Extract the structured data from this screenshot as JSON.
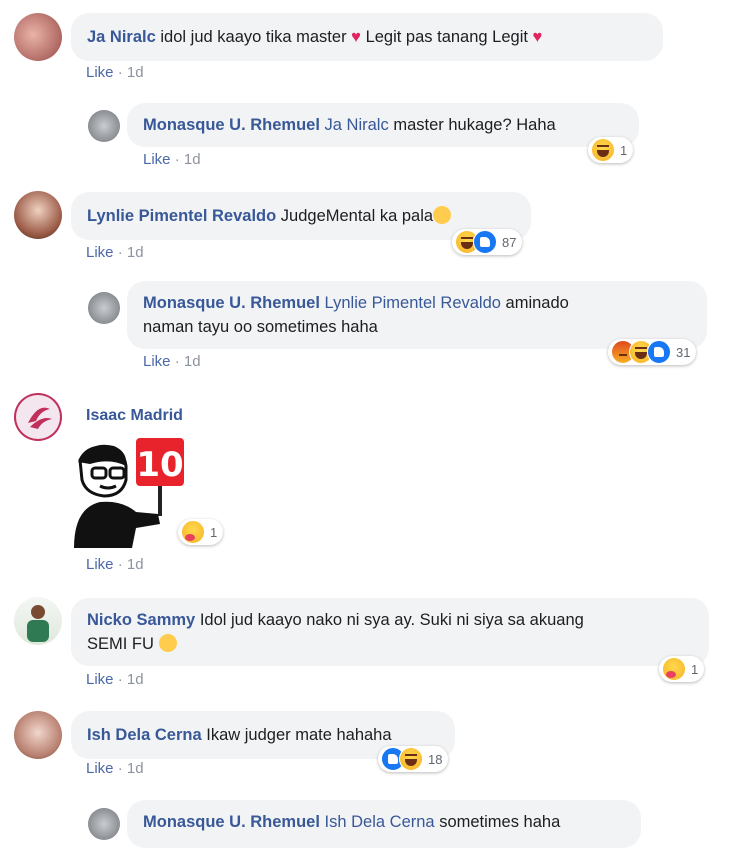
{
  "comments": [
    {
      "name": "Ja Niralc",
      "text": "idol jud kaayo tika master",
      "text2": "Legit pas tanang Legit",
      "like": "Like",
      "time": "1d"
    },
    {
      "name": "Monasque U. Rhemuel",
      "mention": "Ja Niralc",
      "text": "master hukage? Haha",
      "like": "Like",
      "time": "1d",
      "count": "1"
    },
    {
      "name": "Lynlie Pimentel Revaldo",
      "text": "JudgeMental ka pala",
      "like": "Like",
      "time": "1d",
      "count": "87"
    },
    {
      "name": "Monasque U. Rhemuel",
      "mention": "Lynlie Pimentel Revaldo",
      "text": "aminado",
      "text2": "naman tayu oo sometimes haha",
      "like": "Like",
      "time": "1d",
      "count": "31"
    },
    {
      "name": "Isaac Madrid",
      "sticker": "10",
      "like": "Like",
      "time": "1d",
      "count": "1"
    },
    {
      "name": "Nicko Sammy",
      "text": "Idol jud kaayo nako ni sya ay. Suki ni siya sa akuang",
      "text2": "SEMI FU",
      "like": "Like",
      "time": "1d",
      "count": "1"
    },
    {
      "name": "Ish Dela Cerna",
      "text": "Ikaw judger mate hahaha",
      "like": "Like",
      "time": "1d",
      "count": "18"
    },
    {
      "name": "Monasque U. Rhemuel",
      "mention": "Ish Dela Cerna",
      "text": "sometimes haha"
    }
  ],
  "separator": "·",
  "colors": {
    "link": "#385898",
    "bubble": "#f2f3f5",
    "heart": "#e0245e",
    "like_blue": "#1877f2"
  },
  "icons": [
    "heart-icon",
    "haha-reaction-icon",
    "like-reaction-icon",
    "care-reaction-icon",
    "angry-reaction-icon",
    "grin-emoji-icon",
    "rofl-emoji-icon"
  ]
}
